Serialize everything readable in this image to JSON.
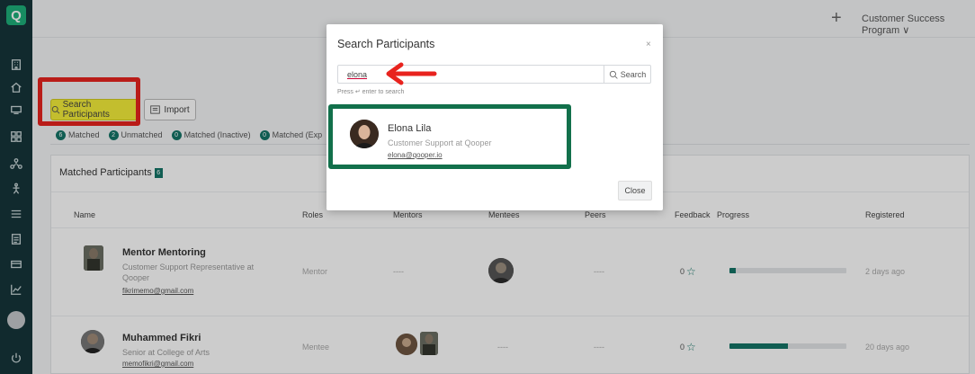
{
  "app": {
    "logo_letter": "Q"
  },
  "topbar": {
    "plus": "+",
    "program": "Customer Success Program",
    "chevron": "∨"
  },
  "actions": {
    "search_label": "Search Participants",
    "import_label": "Import"
  },
  "tabs": [
    {
      "count": "6",
      "label": "Matched"
    },
    {
      "count": "2",
      "label": "Unmatched"
    },
    {
      "count": "0",
      "label": "Matched (Inactive)"
    },
    {
      "count": "0",
      "label": "Matched (Exp"
    }
  ],
  "card": {
    "title": "Matched Participants",
    "count": "6",
    "headers": [
      "Name",
      "Roles",
      "Mentors",
      "Mentees",
      "Peers",
      "Feedback",
      "Progress",
      "Registered"
    ],
    "rows": [
      {
        "name": "Mentor Mentoring",
        "title_line1": "Customer Support Representative at",
        "title_line2": "Qooper",
        "email": "fikrimemo@gmail.com",
        "role": "Mentor",
        "mentors": "----",
        "peers": "----",
        "feedback": "0",
        "progress": 0.05,
        "registered": "2 days ago"
      },
      {
        "name": "Muhammed Fikri",
        "title_line1": "Senior at College of Arts",
        "title_line2": "",
        "email": "memofikri@gmail.com",
        "role": "Mentee",
        "mentees": "----",
        "peers": "----",
        "feedback": "0",
        "progress": 0.5,
        "registered": "20 days ago"
      }
    ]
  },
  "modal": {
    "title": "Search Participants",
    "close_x": "×",
    "search_value": "elona",
    "search_button": "Search",
    "hint": "Press ↵ enter to search",
    "result": {
      "name": "Elona Lila",
      "title": "Customer Support at Qooper",
      "email": "elona@qooper.io"
    },
    "close_button": "Close"
  },
  "colors": {
    "accent": "#147567",
    "sidebar": "#16353a",
    "highlight": "#f4ee3a",
    "annotation_red": "#e8231e",
    "annotation_green": "#12704b"
  }
}
